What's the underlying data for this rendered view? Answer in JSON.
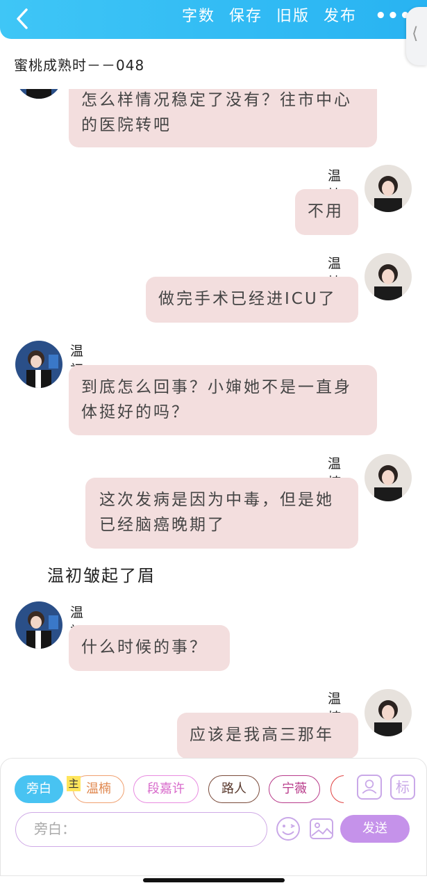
{
  "topbar": {
    "actions": [
      "字数",
      "保存",
      "旧版",
      "发布"
    ],
    "more": "•••",
    "side_tab": "⟨"
  },
  "doc_title": "蜜桃成熟时－－048",
  "messages": [
    {
      "name": "",
      "text": "怎么样情况稳定了没有？往市中心的医院转吧"
    },
    {
      "name": "温楠",
      "text": "不用"
    },
    {
      "name": "温楠",
      "text": "做完手术已经进ICU了"
    },
    {
      "name": "温初",
      "text": "到底怎么回事？小婶她不是一直身体挺好的吗？"
    },
    {
      "name": "温楠",
      "text": "这次发病是因为中毒，但是她已经脑癌晚期了"
    },
    {
      "name": "温初",
      "text": "什么时候的事？"
    },
    {
      "name": "温楠",
      "text": "应该是我高三那年"
    }
  ],
  "narration": "温初皱起了眉",
  "roles": [
    "旁白",
    "温楠",
    "段嘉许",
    "路人",
    "宁薇"
  ],
  "main_badge": "主",
  "tag_button": "标",
  "input": {
    "placeholder": "旁白："
  },
  "send_label": "发送",
  "colors": {
    "accent": "#28b3f2",
    "bubble": "#f3dede",
    "send": "#c592ea",
    "role_borders": [
      "#48c3f2",
      "#f0a070",
      "#e88be0",
      "#7a4a3a",
      "#b83a8a",
      "#e04040"
    ]
  }
}
